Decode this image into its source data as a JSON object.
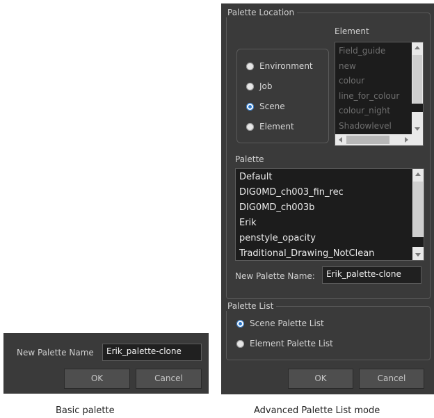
{
  "basic": {
    "new_palette_label": "New Palette Name",
    "new_palette_value": "Erik_palette-clone",
    "ok_label": "OK",
    "cancel_label": "Cancel",
    "caption": "Basic palette"
  },
  "advanced": {
    "palette_location_title": "Palette Location",
    "element_header": "Element",
    "location_options": [
      {
        "label": "Environment",
        "checked": false
      },
      {
        "label": "Job",
        "checked": false
      },
      {
        "label": "Scene",
        "checked": true
      },
      {
        "label": "Element",
        "checked": false
      }
    ],
    "element_items": [
      "Field_guide",
      "new",
      "colour",
      "line_for_colour",
      "colour_night",
      "Shadowlevel"
    ],
    "palette_header": "Palette",
    "palette_items": [
      "Default",
      "DIG0MD_ch003_fin_rec",
      "DIG0MD_ch003b",
      "Erik",
      "penstyle_opacity",
      "Traditional_Drawing_NotClean"
    ],
    "new_palette_label": "New Palette Name:",
    "new_palette_value": "Erik_palette-clone",
    "palette_list_title": "Palette List",
    "list_options": [
      {
        "label": "Scene Palette List",
        "checked": true
      },
      {
        "label": "Element Palette List",
        "checked": false
      }
    ],
    "ok_label": "OK",
    "cancel_label": "Cancel",
    "caption": "Advanced Palette List mode"
  },
  "colors": {
    "panel_bg": "#3a3a3a",
    "list_bg": "#1c1c1c",
    "radio_accent": "#2a75c7"
  }
}
